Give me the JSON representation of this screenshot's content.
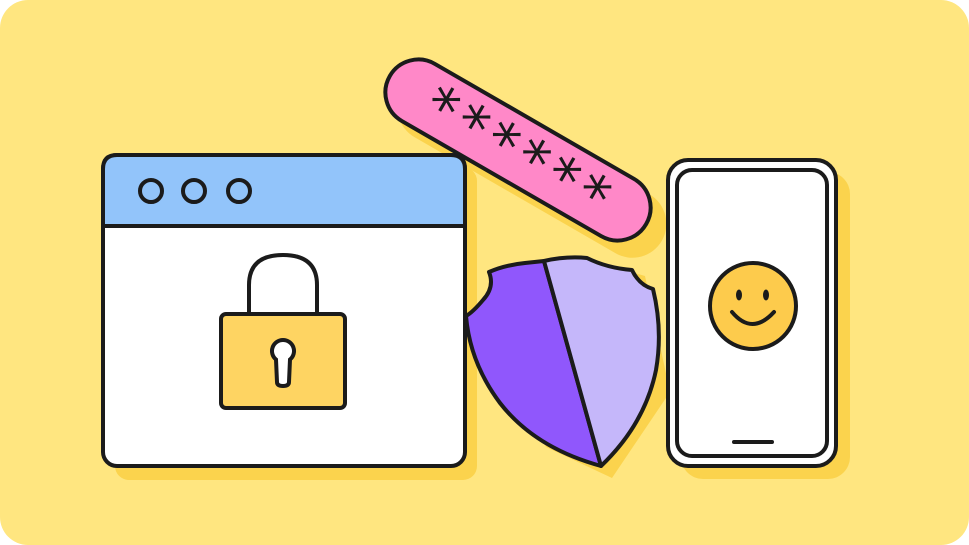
{
  "colors": {
    "background": "#FFE680",
    "shadow": "#FBD34D",
    "outline": "#1B1B1B",
    "window_bar": "#92C4FA",
    "window_body": "#FFFFFF",
    "lock_body": "#FED462",
    "password_pill": "#FF88C8",
    "shield_left": "#9057FC",
    "shield_right": "#C5B7FA",
    "phone_screen": "#FFFFFF",
    "smiley": "#FDCB4C"
  },
  "browser_window": {
    "dots": [
      "window-dot-1",
      "window-dot-2",
      "window-dot-3"
    ],
    "icon": "padlock-icon"
  },
  "password_field": {
    "masked_value": "******"
  },
  "shield": {
    "icon": "shield-icon"
  },
  "phone": {
    "icon": "smiley-face-icon"
  }
}
